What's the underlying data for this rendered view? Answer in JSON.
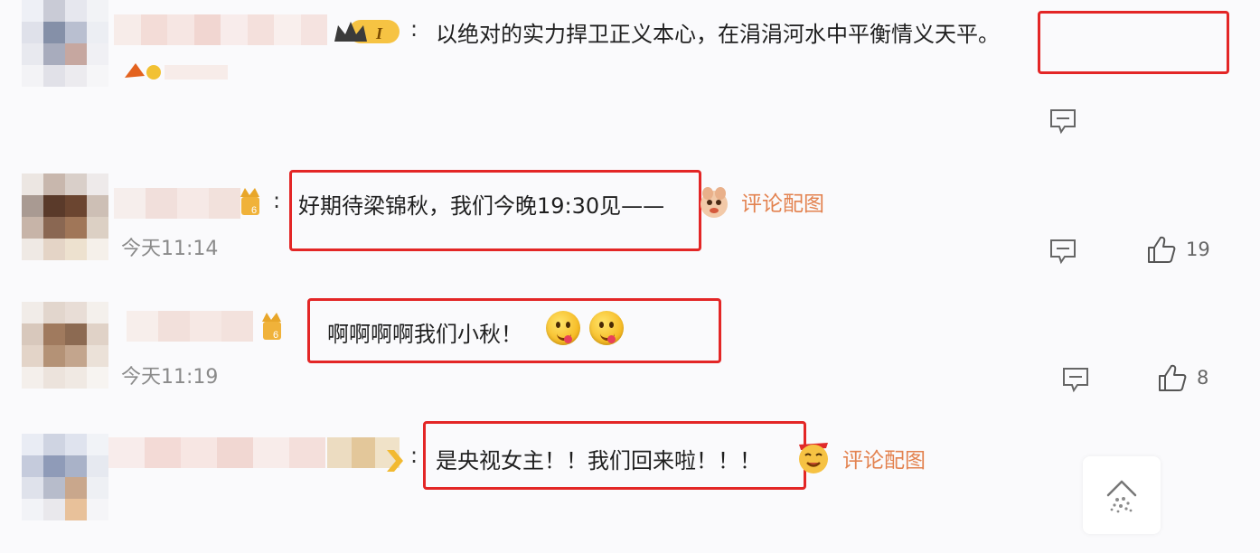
{
  "comments": [
    {
      "text": "以绝对的实力捍卫正义本心，在涓涓河水中平衡情义天平。",
      "colon": ":",
      "badge_label": "I"
    },
    {
      "text": "好期待梁锦秋，我们今晚19:30见——",
      "colon": ":",
      "timestamp": "今天11:14",
      "pic_link": "评论配图",
      "like_count": "19"
    },
    {
      "text": "啊啊啊啊我们小秋！",
      "timestamp": "今天11:19",
      "like_count": "8"
    },
    {
      "text": "是央视女主！！我们回来啦！！！",
      "colon": ":",
      "pic_link": "评论配图"
    }
  ],
  "colors": {
    "highlight_box": "#e32626",
    "link": "#e3824f",
    "timestamp": "#8a8a8a",
    "background": "#fafafc"
  },
  "icons": {
    "reply": "reply-icon",
    "like": "thumbs-up-icon",
    "scroll_top": "scroll-top-icon"
  }
}
